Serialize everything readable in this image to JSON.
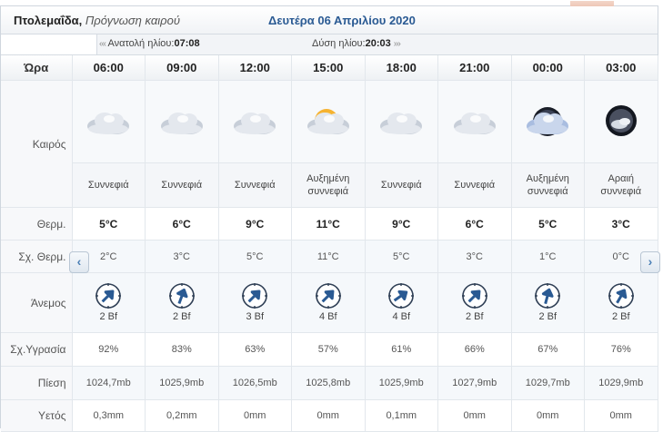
{
  "header": {
    "city": "Πτολεμαΐδα,",
    "subtitle": "Πρόγνωση καιρού",
    "date": "Δευτέρα 06 Απριλίου 2020"
  },
  "sun": {
    "sunrise_label": "Ανατολή ηλίου:",
    "sunrise": "07:08",
    "sunset_label": "Δύση ηλίου:",
    "sunset": "20:03",
    "left_arrows": "‹‹‹",
    "right_arrows": "›››"
  },
  "labels": {
    "hour": "Ώρα",
    "weather": "Καιρός",
    "temp": "Θερμ.",
    "feels": "Σχ. Θερμ.",
    "wind": "Άνεμος",
    "humidity": "Σχ.Υγρασία",
    "pressure": "Πίεση",
    "rain": "Υετός"
  },
  "nav": {
    "prev": "‹",
    "next": "›"
  },
  "columns": [
    {
      "time": "06:00",
      "icon": "cloudy-icon",
      "desc1": "Συννεφιά",
      "desc2": "",
      "temp": "5°C",
      "feels": "2°C",
      "wind": "2 Bf",
      "wind_dir": 225,
      "humidity": "92%",
      "pressure": "1024,7mb",
      "rain": "0,3mm"
    },
    {
      "time": "09:00",
      "icon": "cloudy-icon",
      "desc1": "Συννεφιά",
      "desc2": "",
      "temp": "6°C",
      "feels": "3°C",
      "wind": "2 Bf",
      "wind_dir": 200,
      "humidity": "83%",
      "pressure": "1025,9mb",
      "rain": "0,2mm"
    },
    {
      "time": "12:00",
      "icon": "cloudy-icon",
      "desc1": "Συννεφιά",
      "desc2": "",
      "temp": "9°C",
      "feels": "5°C",
      "wind": "3 Bf",
      "wind_dir": 225,
      "humidity": "63%",
      "pressure": "1026,5mb",
      "rain": "0mm"
    },
    {
      "time": "15:00",
      "icon": "partly-cloudy-sun-icon",
      "desc1": "Αυξημένη",
      "desc2": "συννεφιά",
      "temp": "11°C",
      "feels": "11°C",
      "wind": "4 Bf",
      "wind_dir": 225,
      "humidity": "57%",
      "pressure": "1025,8mb",
      "rain": "0mm"
    },
    {
      "time": "18:00",
      "icon": "cloudy-icon",
      "desc1": "Συννεφιά",
      "desc2": "",
      "temp": "9°C",
      "feels": "5°C",
      "wind": "4 Bf",
      "wind_dir": 235,
      "humidity": "61%",
      "pressure": "1025,9mb",
      "rain": "0,1mm"
    },
    {
      "time": "21:00",
      "icon": "cloudy-icon",
      "desc1": "Συννεφιά",
      "desc2": "",
      "temp": "6°C",
      "feels": "3°C",
      "wind": "2 Bf",
      "wind_dir": 225,
      "humidity": "66%",
      "pressure": "1027,9mb",
      "rain": "0mm"
    },
    {
      "time": "00:00",
      "icon": "partly-cloudy-night-icon",
      "desc1": "Αυξημένη",
      "desc2": "συννεφιά",
      "temp": "5°C",
      "feels": "1°C",
      "wind": "2 Bf",
      "wind_dir": 195,
      "humidity": "67%",
      "pressure": "1029,7mb",
      "rain": "0mm"
    },
    {
      "time": "03:00",
      "icon": "few-clouds-night-icon",
      "desc1": "Αραιή",
      "desc2": "συννεφιά",
      "temp": "3°C",
      "feels": "0°C",
      "wind": "2 Bf",
      "wind_dir": 210,
      "humidity": "76%",
      "pressure": "1029,9mb",
      "rain": "0mm"
    }
  ]
}
